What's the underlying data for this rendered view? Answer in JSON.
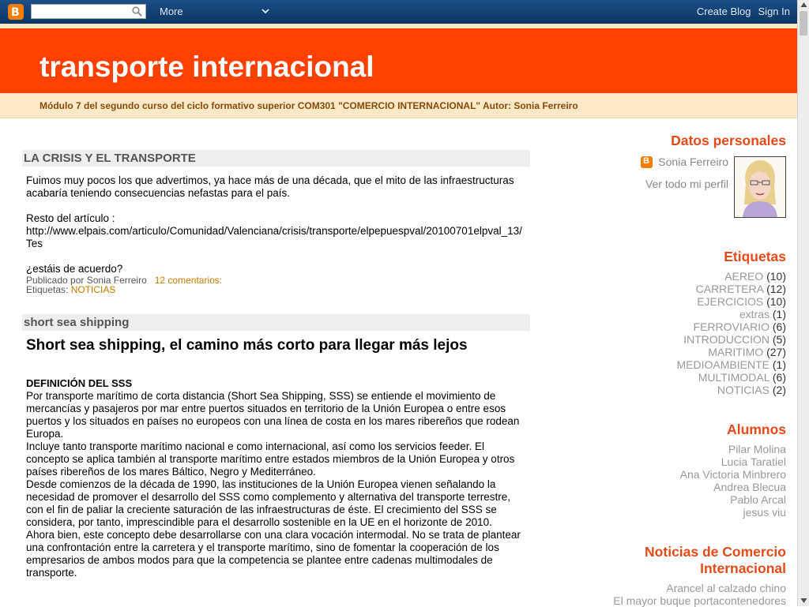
{
  "navbar": {
    "more_label": "More",
    "search_placeholder": "",
    "create_blog": "Create Blog",
    "sign_in": "Sign In",
    "logo_letter": "B"
  },
  "header": {
    "title": "transporte internacional",
    "description": "Módulo 7 del segundo curso del ciclo formativo superior COM301 \"COMERCIO INTERNACIONAL\" Autor: Sonia Ferreiro"
  },
  "posts": [
    {
      "heading": "LA CRISIS Y EL TRANSPORTE",
      "para1": "Fuimos muy pocos los que advertimos, ya hace más de una década, que el mito de las infraestructuras acabaría teniendo consecuencias nefastas para el país.",
      "para2_line1": "Resto del artículo :",
      "para2_url": "http://www.elpais.com/articulo/Comunidad/Valenciana/crisis/transporte/elpepuespval/20100701elpval_13/Tes",
      "question": "¿estáis de acuerdo?",
      "published_by": "Publicado por Sonia Ferreiro",
      "comments": "12 comentarios:",
      "labels_prefix": "Etiquetas:",
      "label": "NOTICIAS"
    },
    {
      "heading": "short sea shipping",
      "title": "Short sea shipping, el camino más corto para llegar más lejos",
      "def_title": "DEFINICIÓN DEL SSS",
      "p1": "Por transporte marítimo de corta distancia (Short Sea Shipping, SSS) se entiende el movimiento de mercancías y pasajeros por mar entre puertos situados en territorio de la Unión Europea o entre esos puertos y los situados en países no europeos con una línea de costa en los mares ribereños que rodean Europa.",
      "p2": "Incluye tanto transporte marítimo nacional e como internacional, así como los servicios feeder. El concepto se aplica también al transporte marítimo entre estados miembros de la Unión Europea y otros países ribereños de los mares Báltico, Negro y Mediterráneo.",
      "p3": "Desde comienzos de la década de 1990, las instituciones de la Unión Europea vienen señalando la necesidad de promover el desarrollo del SSS como complemento y alternativa del transporte terrestre, con el fin de paliar la creciente saturación de las infraestructuras de éste. El crecimiento del SSS se considera, por tanto, imprescindible para el desarrollo sostenible en la UE en el horizonte de 2010.",
      "p4": "Ahora bien, este concepto debe desarrollarse con una clara vocación intermodal. No se trata de plantear una confrontación entre la carretera y el transporte marítimo, sino de fomentar la cooperación de los empresarios de ambos modos para que la competencia se plantee entre cadenas multimodales de transporte."
    }
  ],
  "sidebar": {
    "profile_heading": "Datos personales",
    "profile_name": "Sonia Ferreiro",
    "profile_more": "Ver todo mi perfil",
    "labels_heading": "Etiquetas",
    "labels": [
      {
        "name": "AEREO",
        "count": "(10)"
      },
      {
        "name": "CARRETERA",
        "count": "(12)"
      },
      {
        "name": "EJERCICIOS",
        "count": "(10)"
      },
      {
        "name": "extras",
        "count": "(1)"
      },
      {
        "name": "FERROVIARIO",
        "count": "(6)"
      },
      {
        "name": "INTRODUCCION",
        "count": "(5)"
      },
      {
        "name": "MARITIMO",
        "count": "(27)"
      },
      {
        "name": "MEDIOAMBIENTE",
        "count": "(1)"
      },
      {
        "name": "MULTIMODAL",
        "count": "(6)"
      },
      {
        "name": "NOTICIAS",
        "count": "(2)"
      }
    ],
    "alumnos_heading": "Alumnos",
    "alumnos": [
      "Pilar Molina",
      "Lucia Taratiel",
      "Ana Victoria Minbrero",
      "Andrea Blecua",
      "Pablo Arcal",
      "jesus viu"
    ],
    "noticias_heading_1": "Noticias de Comercio",
    "noticias_heading_2": "Internacional",
    "noticias": [
      "Arancel al calzado chino",
      "El mayor buque portacontenedores"
    ]
  },
  "colors": {
    "header_bg": "#fe4000",
    "desc_bg": "#fde9c8",
    "navbar_bg": "#0b3563",
    "accent_link": "#cc7a00",
    "sidebar_heading": "#e64a19"
  }
}
